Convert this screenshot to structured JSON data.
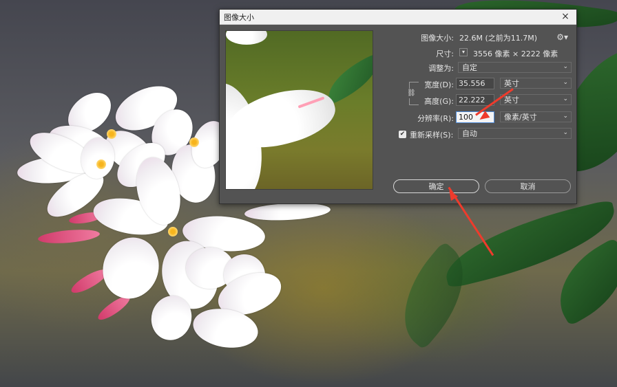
{
  "dialog": {
    "title": "图像大小",
    "close_glyph": "×",
    "image_size_label": "图像大小:",
    "image_size_value": "22.6M (之前为11.7M)",
    "dimensions_label": "尺寸:",
    "dimensions_value": "3556 像素 × 2222 像素",
    "fit_to_label": "调整为:",
    "fit_to_value": "自定",
    "width_label": "宽度(D):",
    "width_value": "35.556",
    "width_unit": "英寸",
    "height_label": "高度(G):",
    "height_value": "22.222",
    "height_unit": "英寸",
    "resolution_label": "分辨率(R):",
    "resolution_value": "100",
    "resolution_unit": "像素/英寸",
    "resample_label": "重新采样(S):",
    "resample_value": "自动",
    "resample_checked": true,
    "ok_label": "确定",
    "cancel_label": "取消"
  },
  "icons": {
    "gear": "gear-icon",
    "chain": "chain-link-icon",
    "chevron": "chevron-down-icon",
    "checkmark": "checkmark-icon",
    "close": "close-icon"
  },
  "colors": {
    "dialog_bg": "#535353",
    "active_input_border": "#4d8ad8",
    "annotation_arrow": "#ee3b2c"
  }
}
